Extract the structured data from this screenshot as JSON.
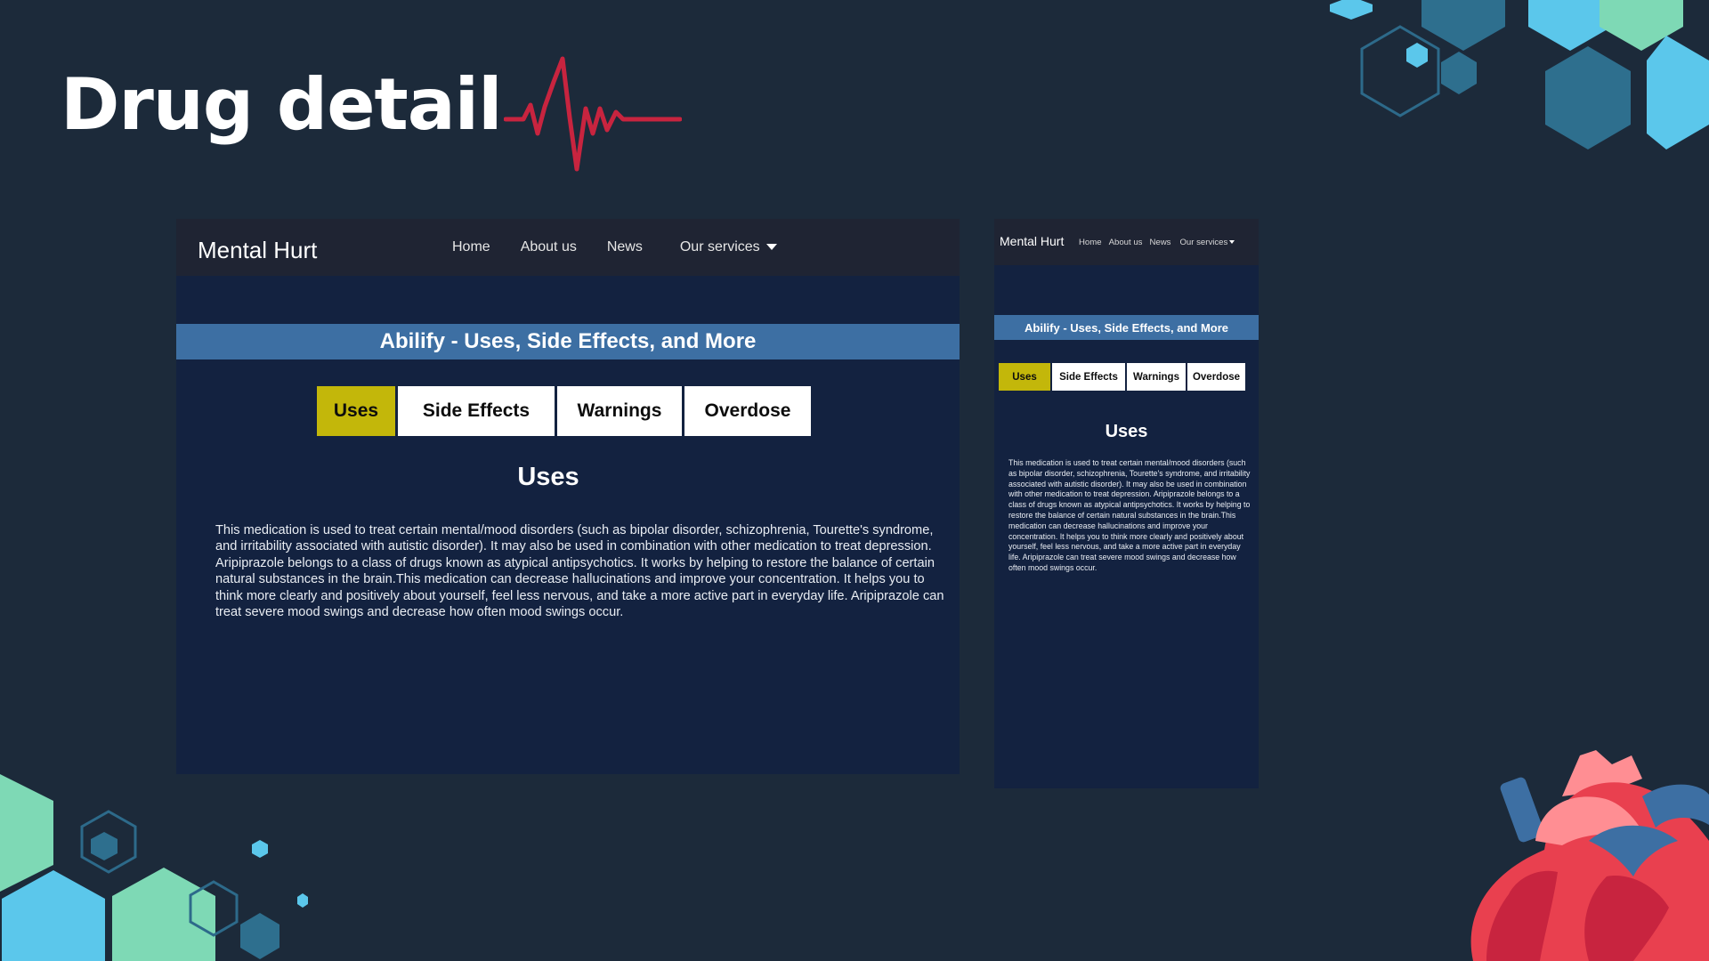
{
  "slide": {
    "title": "Drug detail",
    "accent_color": "#c8243f"
  },
  "site": {
    "brand": "Mental Hurt",
    "nav": [
      "Home",
      "About us",
      "News",
      "Our services"
    ],
    "banner": "Abilify - Uses, Side Effects, and More",
    "tabs": [
      "Uses",
      "Side Effects",
      "Warnings",
      "Overdose"
    ],
    "active_tab": "Uses",
    "section_heading": "Uses",
    "body": "This medication is used to treat certain mental/mood disorders (such as bipolar disorder, schizophrenia, Tourette's syndrome, and irritability associated with autistic disorder). It may also be used in combination with other medication to treat depression. Aripiprazole belongs to a class of drugs known as atypical antipsychotics. It works by helping to restore the balance of certain natural substances in the brain.This medication can decrease hallucinations and improve your concentration. It helps you to think more clearly and positively about yourself, feel less nervous, and take a more active part in everyday life. Aripiprazole can treat severe mood swings and decrease how often mood swings occur.",
    "colors": {
      "page_background": "#132240",
      "navbar": "#1f2433",
      "banner": "#3d6fa3",
      "active_tab": "#c3b70a",
      "tab": "#ffffff"
    }
  },
  "icons": {
    "dropdown": "caret-down-icon",
    "heartbeat": "heartbeat-icon",
    "heart": "anatomical-heart-illustration"
  }
}
